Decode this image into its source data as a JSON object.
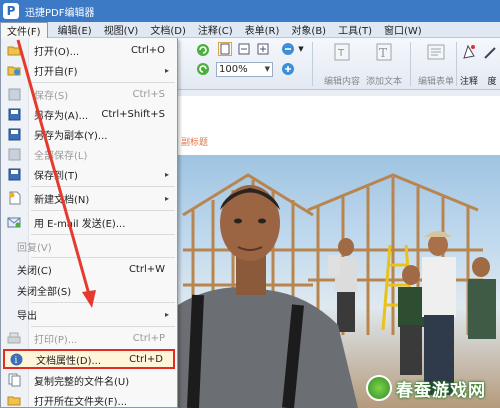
{
  "app": {
    "title": "迅捷PDF编辑器",
    "logo_letter": "P"
  },
  "menubar": {
    "items": [
      {
        "label": "文件(F)"
      },
      {
        "label": "编辑(E)"
      },
      {
        "label": "视图(V)"
      },
      {
        "label": "文档(D)"
      },
      {
        "label": "注释(C)"
      },
      {
        "label": "表单(R)"
      },
      {
        "label": "对象(B)"
      },
      {
        "label": "工具(T)"
      },
      {
        "label": "窗口(W)"
      }
    ]
  },
  "toolbar": {
    "zoom_value": "100%",
    "buttons": [
      {
        "label": "编辑内容"
      },
      {
        "label": "添加文本"
      },
      {
        "label": "编辑表单"
      },
      {
        "label": "注释"
      },
      {
        "label": "度"
      }
    ]
  },
  "document": {
    "subtitle": "副标题"
  },
  "file_menu": {
    "items": [
      {
        "label": "打开(O)...",
        "shortcut": "Ctrl+O",
        "icon": "open-folder-icon"
      },
      {
        "label": "打开自(F)",
        "shortcut": "",
        "icon": "open-from-icon"
      },
      {
        "label": "保存(S)",
        "shortcut": "Ctrl+S",
        "icon": "save-icon"
      },
      {
        "label": "另存为(A)...",
        "shortcut": "Ctrl+Shift+S",
        "icon": "save-as-icon"
      },
      {
        "label": "另存为副本(Y)...",
        "shortcut": "",
        "icon": "save-copy-icon"
      },
      {
        "label": "全部保存(L)",
        "shortcut": "",
        "icon": "save-all-icon"
      },
      {
        "label": "保存到(T)",
        "shortcut": "",
        "icon": "save-to-icon"
      },
      {
        "label": "新建文档(N)",
        "shortcut": "",
        "icon": "new-document-icon"
      },
      {
        "label": "用 E-mail 发送(E)...",
        "shortcut": "",
        "icon": "email-icon"
      },
      {
        "label": "回复(V)",
        "shortcut": ""
      },
      {
        "label": "关闭(C)",
        "shortcut": "Ctrl+W"
      },
      {
        "label": "关闭全部(S)",
        "shortcut": ""
      },
      {
        "label": "导出",
        "shortcut": ""
      },
      {
        "label": "打印(P)...",
        "shortcut": "Ctrl+P",
        "icon": "print-icon"
      },
      {
        "label": "文档属性(D)...",
        "shortcut": "Ctrl+D",
        "icon": "document-properties-icon"
      },
      {
        "label": "复制完整的文件名(U)",
        "shortcut": "",
        "icon": "copy-filename-icon"
      },
      {
        "label": "打开所在文件夹(F)...",
        "shortcut": "",
        "icon": "open-containing-folder-icon"
      }
    ]
  },
  "colors": {
    "highlight_border": "#e22c24",
    "arrow": "#e53b2f",
    "titlebar": "#3d7ac6"
  },
  "watermark": {
    "text": "春蚕游戏网"
  }
}
